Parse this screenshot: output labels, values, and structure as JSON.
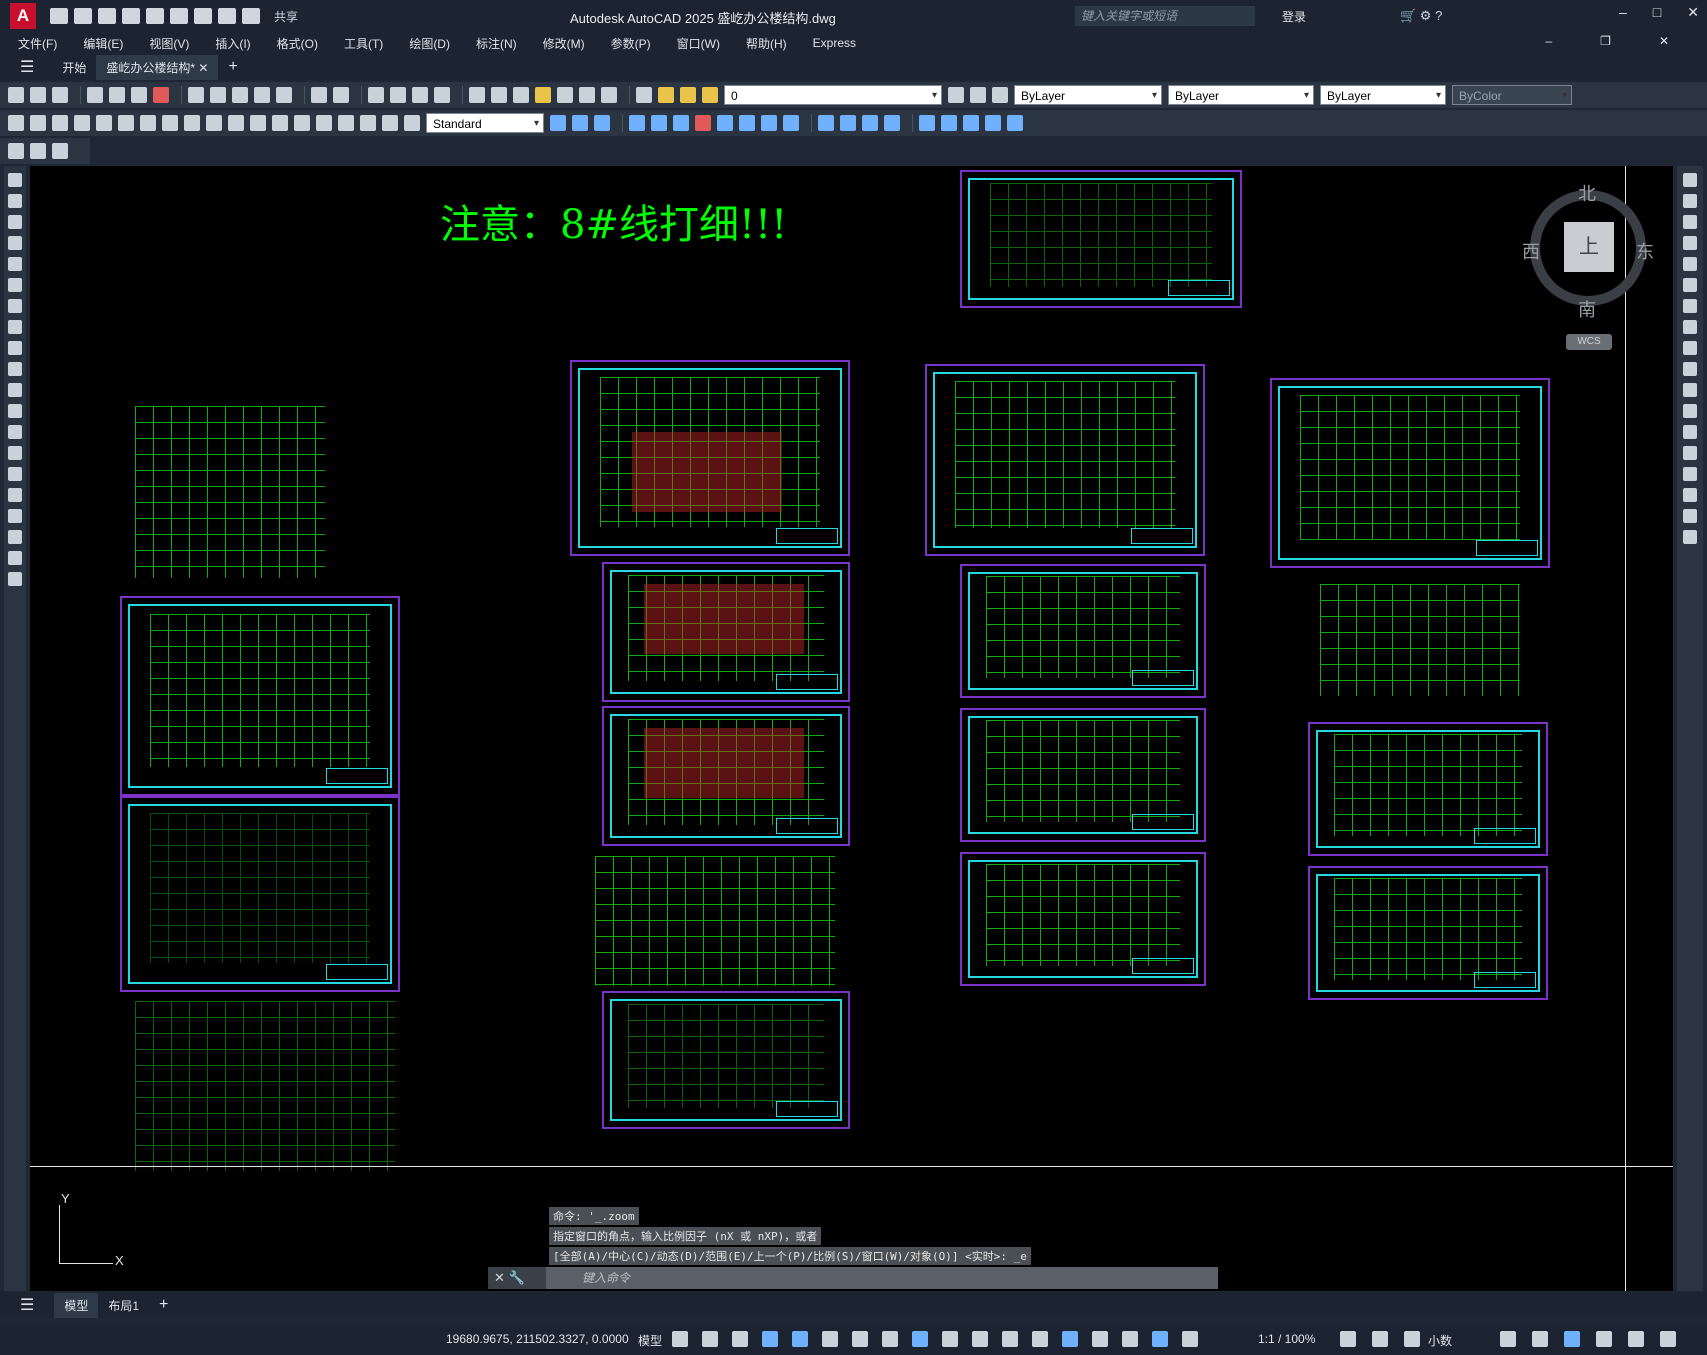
{
  "titlebar": {
    "logo": "A",
    "share": "共享",
    "title": "Autodesk AutoCAD 2025    盛屹办公楼结构.dwg",
    "search_placeholder": "键入关键字或短语",
    "login": "登录"
  },
  "menu": [
    "文件(F)",
    "编辑(E)",
    "视图(V)",
    "插入(I)",
    "格式(O)",
    "工具(T)",
    "绘图(D)",
    "标注(N)",
    "修改(M)",
    "参数(P)",
    "窗口(W)",
    "帮助(H)",
    "Express"
  ],
  "tabs": {
    "start": "开始",
    "file": "盛屹办公楼结构*"
  },
  "toolbar": {
    "layer": "0",
    "color": "ByLayer",
    "linetype": "ByLayer",
    "lineweight": "ByLayer",
    "plotstyle": "ByColor",
    "textstyle": "Standard"
  },
  "canvas": {
    "note": "注意：8#线打细!!!",
    "compass": {
      "n": "北",
      "s": "南",
      "e": "东",
      "w": "西",
      "top": "上"
    },
    "wcs": "WCS",
    "ucs_x": "X",
    "ucs_y": "Y"
  },
  "command": {
    "history1": "命令: '_.zoom",
    "history2": "指定窗口的角点，输入比例因子 (nX 或 nXP)，或者",
    "history3": "[全部(A)/中心(C)/动态(D)/范围(E)/上一个(P)/比例(S)/窗口(W)/对象(O)] <实时>: _e",
    "placeholder": "键入命令"
  },
  "layouts": {
    "model": "模型",
    "layout1": "布局1"
  },
  "status": {
    "coords": "19680.9675, 211502.3327, 0.0000",
    "model": "模型",
    "scale": "1:1 / 100%",
    "units": "小数"
  }
}
